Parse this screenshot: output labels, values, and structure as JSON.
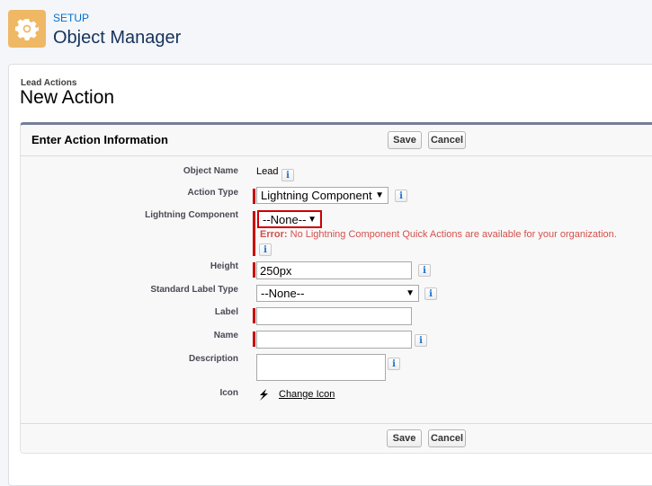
{
  "header": {
    "setup_label": "SETUP",
    "title": "Object Manager",
    "icon": "gear-icon"
  },
  "page": {
    "breadcrumb": "Lead Actions",
    "title": "New Action"
  },
  "panel": {
    "title": "Enter Action Information",
    "save_label": "Save",
    "cancel_label": "Cancel"
  },
  "fields": {
    "object_name": {
      "label": "Object Name",
      "value": "Lead"
    },
    "action_type": {
      "label": "Action Type",
      "value": "Lightning Component"
    },
    "lightning_component": {
      "label": "Lightning Component",
      "value": "--None--",
      "error_prefix": "Error:",
      "error_text": " No Lightning Component Quick Actions are available for your organization."
    },
    "height": {
      "label": "Height",
      "value": "250px"
    },
    "standard_label_type": {
      "label": "Standard Label Type",
      "value": "--None--"
    },
    "label": {
      "label": "Label",
      "value": ""
    },
    "name": {
      "label": "Name",
      "value": ""
    },
    "description": {
      "label": "Description",
      "value": ""
    },
    "icon": {
      "label": "Icon",
      "link": "Change Icon",
      "icon": "lightning-bolt-icon"
    }
  },
  "info_glyph": "i",
  "colors": {
    "required": "#cc0000",
    "error": "#d4504c",
    "accent": "#0070d2",
    "app_icon": "#efb865"
  }
}
